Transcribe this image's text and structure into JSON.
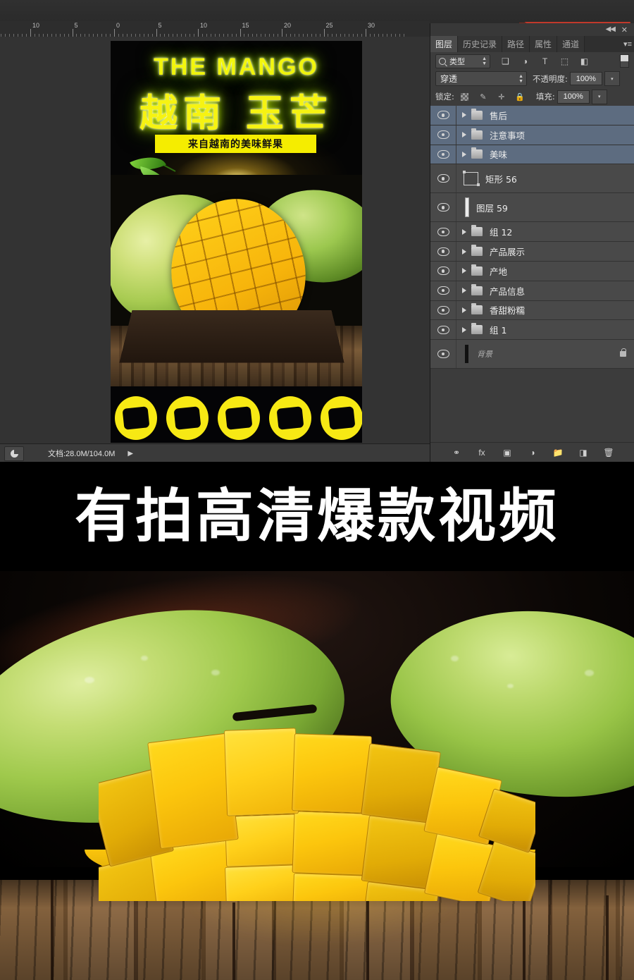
{
  "app": {
    "status_bar": {
      "doc_info": "文档:28.0M/104.0M",
      "expand_arrow": "▶",
      "preview_icon": "preview-pie-icon"
    },
    "ruler": {
      "unit_labels": [
        "10",
        "5",
        "0",
        "5",
        "10",
        "15",
        "20",
        "25",
        "30"
      ]
    }
  },
  "panel": {
    "title_controls": {
      "collapse": "◀◀",
      "close": "✕"
    },
    "tabs": [
      {
        "label": "图层",
        "active": true
      },
      {
        "label": "历史记录",
        "active": false
      },
      {
        "label": "路径",
        "active": false
      },
      {
        "label": "属性",
        "active": false
      },
      {
        "label": "通道",
        "active": false
      }
    ],
    "tab_menu_icon": "▾≡",
    "filter": {
      "search_icon": "search-icon",
      "type_label": "类型",
      "spinner": "↕",
      "icons": [
        {
          "name": "pixel-layer-filter-icon",
          "glyph": "❑"
        },
        {
          "name": "adjustment-layer-filter-icon",
          "glyph": "◑"
        },
        {
          "name": "type-layer-filter-icon",
          "glyph": "T"
        },
        {
          "name": "shape-layer-filter-icon",
          "glyph": "⬚"
        },
        {
          "name": "smart-object-filter-icon",
          "glyph": "◧"
        }
      ],
      "toggle_name": "filter-enable-toggle"
    },
    "blend": {
      "mode_value": "穿透",
      "mode_spinner": "↕",
      "opacity_label": "不透明度:",
      "opacity_value": "100%",
      "opacity_dropdown": "▾"
    },
    "lock": {
      "label": "锁定:",
      "icons": [
        {
          "name": "lock-transparent-pixels-icon",
          "glyph": "checker"
        },
        {
          "name": "lock-image-pixels-icon",
          "glyph": "✐"
        },
        {
          "name": "lock-position-icon",
          "glyph": "✥"
        },
        {
          "name": "lock-all-icon",
          "glyph": "🔒"
        }
      ],
      "fill_label": "填充:",
      "fill_value": "100%",
      "fill_dropdown": "▾"
    },
    "layers": [
      {
        "name": "售后",
        "type": "group",
        "selected": true,
        "expand": "▶",
        "visible": true,
        "locked": false
      },
      {
        "name": "注意事项",
        "type": "group",
        "selected": true,
        "expand": "▶",
        "visible": true,
        "locked": false
      },
      {
        "name": "美味",
        "type": "group",
        "selected": true,
        "expand": "▶",
        "visible": true,
        "locked": false
      },
      {
        "name": "矩形 56",
        "type": "shape",
        "selected": false,
        "expand": "",
        "visible": true,
        "locked": false
      },
      {
        "name": "图层 59",
        "type": "pixel",
        "selected": false,
        "expand": "",
        "visible": true,
        "locked": false
      },
      {
        "name": "组 12",
        "type": "group",
        "selected": false,
        "expand": "▶",
        "visible": true,
        "locked": false
      },
      {
        "name": "产品展示",
        "type": "group",
        "selected": false,
        "expand": "▶",
        "visible": true,
        "locked": false
      },
      {
        "name": "产地",
        "type": "group",
        "selected": false,
        "expand": "▶",
        "visible": true,
        "locked": false
      },
      {
        "name": "产品信息",
        "type": "group",
        "selected": false,
        "expand": "▶",
        "visible": true,
        "locked": false
      },
      {
        "name": "香甜粉糯",
        "type": "group",
        "selected": false,
        "expand": "▶",
        "visible": true,
        "locked": false
      },
      {
        "name": "组 1",
        "type": "group",
        "selected": false,
        "expand": "▶",
        "visible": true,
        "locked": false
      },
      {
        "name": "背景",
        "type": "background",
        "selected": false,
        "expand": "",
        "visible": true,
        "locked": true
      }
    ],
    "footer_icons": [
      {
        "name": "link-layers-icon",
        "glyph": "⚭"
      },
      {
        "name": "layer-style-fx-icon",
        "glyph": "fx"
      },
      {
        "name": "add-layer-mask-icon",
        "glyph": "▣"
      },
      {
        "name": "new-adjustment-layer-icon",
        "glyph": "◑"
      },
      {
        "name": "new-group-icon",
        "glyph": "📁"
      },
      {
        "name": "new-layer-icon",
        "glyph": "◨"
      },
      {
        "name": "delete-layer-icon",
        "glyph": "🗑"
      }
    ]
  },
  "poster": {
    "title_en": "THE MANGO",
    "title_cn": "越南 玉芒",
    "subtitle": "来自越南的美味鲜果",
    "accent_yellow": "#f5ed00",
    "glow_green": "#b6e300"
  },
  "headline": {
    "text": "有拍高清爆款视频",
    "color": "#ffffff",
    "background": "#000000"
  },
  "photo": {
    "alt": "切开的芒果与青芒果放在木桌上",
    "wood_color": "#7a5634",
    "mango_flesh_color": "#fcc60d",
    "mango_skin_color": "#9fc94c"
  }
}
